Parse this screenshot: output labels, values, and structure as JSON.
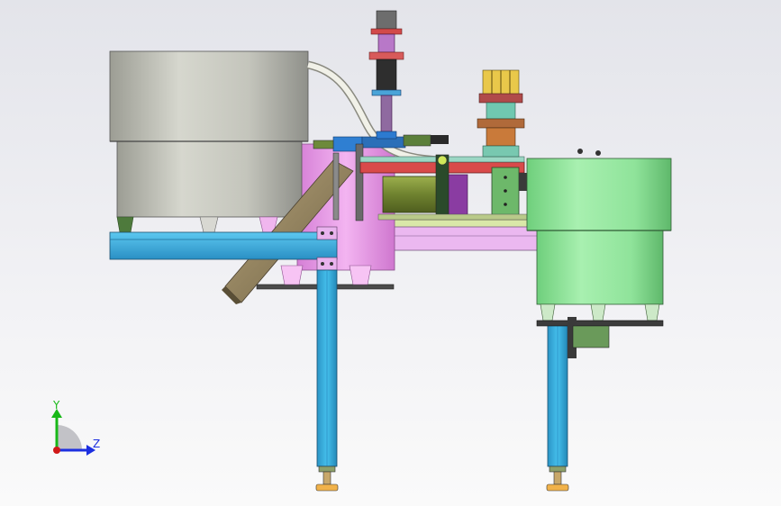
{
  "axes": {
    "y_label": "Y",
    "z_label": "Z"
  },
  "colors": {
    "background": "#e8e9ef",
    "left_bowl": "#c9cac0",
    "right_bowl": "#8fe39a",
    "frame_blue": "#3ab2e0",
    "plate_violet": "#e8b7ee",
    "pink_body": "#ec9de8",
    "motor_green": "#7b8f3a",
    "red_plate": "#d94a4a",
    "axis_y": "#18b818",
    "axis_z": "#1c2fe0",
    "axis_origin": "#d01818"
  }
}
